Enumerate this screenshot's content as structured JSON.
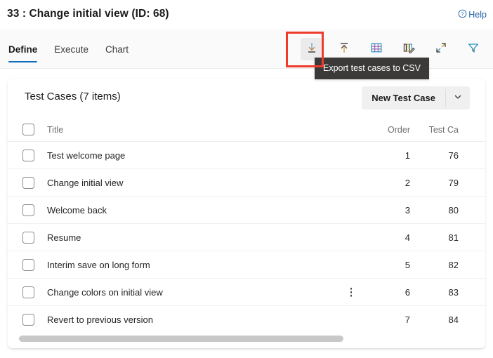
{
  "header": {
    "title": "33 : Change initial view (ID: 68)",
    "help_label": "Help",
    "help_icon": "question-circle-icon"
  },
  "tabs": [
    {
      "label": "Define",
      "active": true
    },
    {
      "label": "Execute",
      "active": false
    },
    {
      "label": "Chart",
      "active": false
    }
  ],
  "toolbar": {
    "buttons": [
      {
        "name": "export-csv",
        "icon": "download-arrow-icon",
        "pressed": true,
        "tooltip": "Export test cases to CSV"
      },
      {
        "name": "import-csv",
        "icon": "upload-arrow-icon",
        "pressed": false
      },
      {
        "name": "grid-view",
        "icon": "table-grid-icon",
        "pressed": false
      },
      {
        "name": "edit-columns",
        "icon": "columns-edit-icon",
        "pressed": false
      },
      {
        "name": "expand",
        "icon": "diagonal-arrows-expand-icon",
        "pressed": false
      },
      {
        "name": "filter",
        "icon": "funnel-filter-icon",
        "pressed": false
      }
    ],
    "active_tooltip": "Export test cases to CSV"
  },
  "card": {
    "title": "Test Cases (7 items)",
    "new_button_label": "New Test Case",
    "new_button_caret_icon": "chevron-down-icon"
  },
  "table": {
    "columns": [
      "Title",
      "Order",
      "Test Ca"
    ],
    "rows": [
      {
        "title": "Test welcome page",
        "order": "1",
        "test_case": "76",
        "kebab": false
      },
      {
        "title": "Change initial view",
        "order": "2",
        "test_case": "79",
        "kebab": false
      },
      {
        "title": "Welcome back",
        "order": "3",
        "test_case": "80",
        "kebab": false
      },
      {
        "title": "Resume",
        "order": "4",
        "test_case": "81",
        "kebab": false
      },
      {
        "title": "Interim save on long form",
        "order": "5",
        "test_case": "82",
        "kebab": false
      },
      {
        "title": "Change colors on initial view",
        "order": "6",
        "test_case": "83",
        "kebab": true
      },
      {
        "title": "Revert to previous version",
        "order": "7",
        "test_case": "84",
        "kebab": false
      }
    ]
  },
  "colors": {
    "accent": "#0f6cbd",
    "link": "#1f5fa9",
    "highlight_box": "#ee3b2b",
    "tooltip_bg": "#3b3a39",
    "button_bg": "#f0f0f0",
    "scrollbar_thumb": "#c8c8c8"
  },
  "scrollbar": {
    "name": "horizontal-scrollbar"
  }
}
